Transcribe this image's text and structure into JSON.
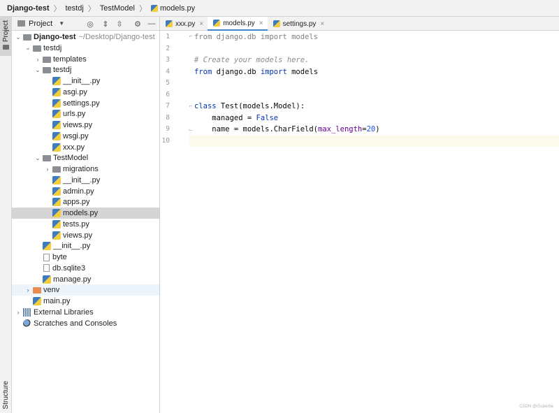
{
  "breadcrumb": [
    "Django-test",
    "testdj",
    "TestModel",
    "models.py"
  ],
  "sidebar": {
    "project_tab": "Project",
    "structure_tab": "Structure"
  },
  "panel": {
    "title": "Project"
  },
  "tree": [
    {
      "label": "Django-test",
      "sub": "~/Desktop/Django-test",
      "indent": 0,
      "arrow": "open",
      "icon": "folder",
      "bold": true
    },
    {
      "label": "testdj",
      "indent": 1,
      "arrow": "open",
      "icon": "folder"
    },
    {
      "label": "templates",
      "indent": 2,
      "arrow": "closed",
      "icon": "folder"
    },
    {
      "label": "testdj",
      "indent": 2,
      "arrow": "open",
      "icon": "folder"
    },
    {
      "label": "__init__.py",
      "indent": 3,
      "icon": "py"
    },
    {
      "label": "asgi.py",
      "indent": 3,
      "icon": "py"
    },
    {
      "label": "settings.py",
      "indent": 3,
      "icon": "py"
    },
    {
      "label": "urls.py",
      "indent": 3,
      "icon": "py"
    },
    {
      "label": "views.py",
      "indent": 3,
      "icon": "py"
    },
    {
      "label": "wsgi.py",
      "indent": 3,
      "icon": "py"
    },
    {
      "label": "xxx.py",
      "indent": 3,
      "icon": "py"
    },
    {
      "label": "TestModel",
      "indent": 2,
      "arrow": "open",
      "icon": "folder"
    },
    {
      "label": "migrations",
      "indent": 3,
      "arrow": "closed",
      "icon": "folder"
    },
    {
      "label": "__init__.py",
      "indent": 3,
      "icon": "py"
    },
    {
      "label": "admin.py",
      "indent": 3,
      "icon": "py"
    },
    {
      "label": "apps.py",
      "indent": 3,
      "icon": "py"
    },
    {
      "label": "models.py",
      "indent": 3,
      "icon": "py",
      "selected": true
    },
    {
      "label": "tests.py",
      "indent": 3,
      "icon": "py"
    },
    {
      "label": "views.py",
      "indent": 3,
      "icon": "py"
    },
    {
      "label": "__init__.py",
      "indent": 2,
      "icon": "py"
    },
    {
      "label": "byte",
      "indent": 2,
      "icon": "file"
    },
    {
      "label": "db.sqlite3",
      "indent": 2,
      "icon": "file"
    },
    {
      "label": "manage.py",
      "indent": 2,
      "icon": "py"
    },
    {
      "label": "venv",
      "indent": 1,
      "arrow": "closed",
      "icon": "folder-orange",
      "highlight": true
    },
    {
      "label": "main.py",
      "indent": 1,
      "icon": "py"
    },
    {
      "label": "External Libraries",
      "indent": 0,
      "arrow": "closed",
      "icon": "lib"
    },
    {
      "label": "Scratches and Consoles",
      "indent": 0,
      "icon": "scratch"
    }
  ],
  "tabs": [
    {
      "label": "xxx.py",
      "active": false
    },
    {
      "label": "models.py",
      "active": true
    },
    {
      "label": "settings.py",
      "active": false
    }
  ],
  "editor": {
    "current_line": 10,
    "lines": [
      {
        "n": "1",
        "tokens": [
          [
            "dim",
            "from django.db import models"
          ]
        ]
      },
      {
        "n": "2",
        "tokens": []
      },
      {
        "n": "3",
        "tokens": [
          [
            "cm",
            "# Create your models here."
          ]
        ]
      },
      {
        "n": "4",
        "tokens": [
          [
            "kw",
            "from"
          ],
          [
            "",
            " django.db "
          ],
          [
            "kw",
            "import"
          ],
          [
            "",
            " models"
          ]
        ]
      },
      {
        "n": "5",
        "tokens": []
      },
      {
        "n": "6",
        "tokens": []
      },
      {
        "n": "7",
        "tokens": [
          [
            "kw",
            "class"
          ],
          [
            "",
            " Test(models.Model):"
          ]
        ]
      },
      {
        "n": "8",
        "tokens": [
          [
            "",
            "    managed = "
          ],
          [
            "kw",
            "False"
          ]
        ]
      },
      {
        "n": "9",
        "tokens": [
          [
            "",
            "    name = models.CharField("
          ],
          [
            "kp",
            "max_length"
          ],
          [
            "",
            "="
          ],
          [
            "num",
            "20"
          ],
          [
            "",
            ")"
          ]
        ]
      },
      {
        "n": "10",
        "tokens": []
      }
    ]
  },
  "watermark": "CSDN @iSuperbe"
}
